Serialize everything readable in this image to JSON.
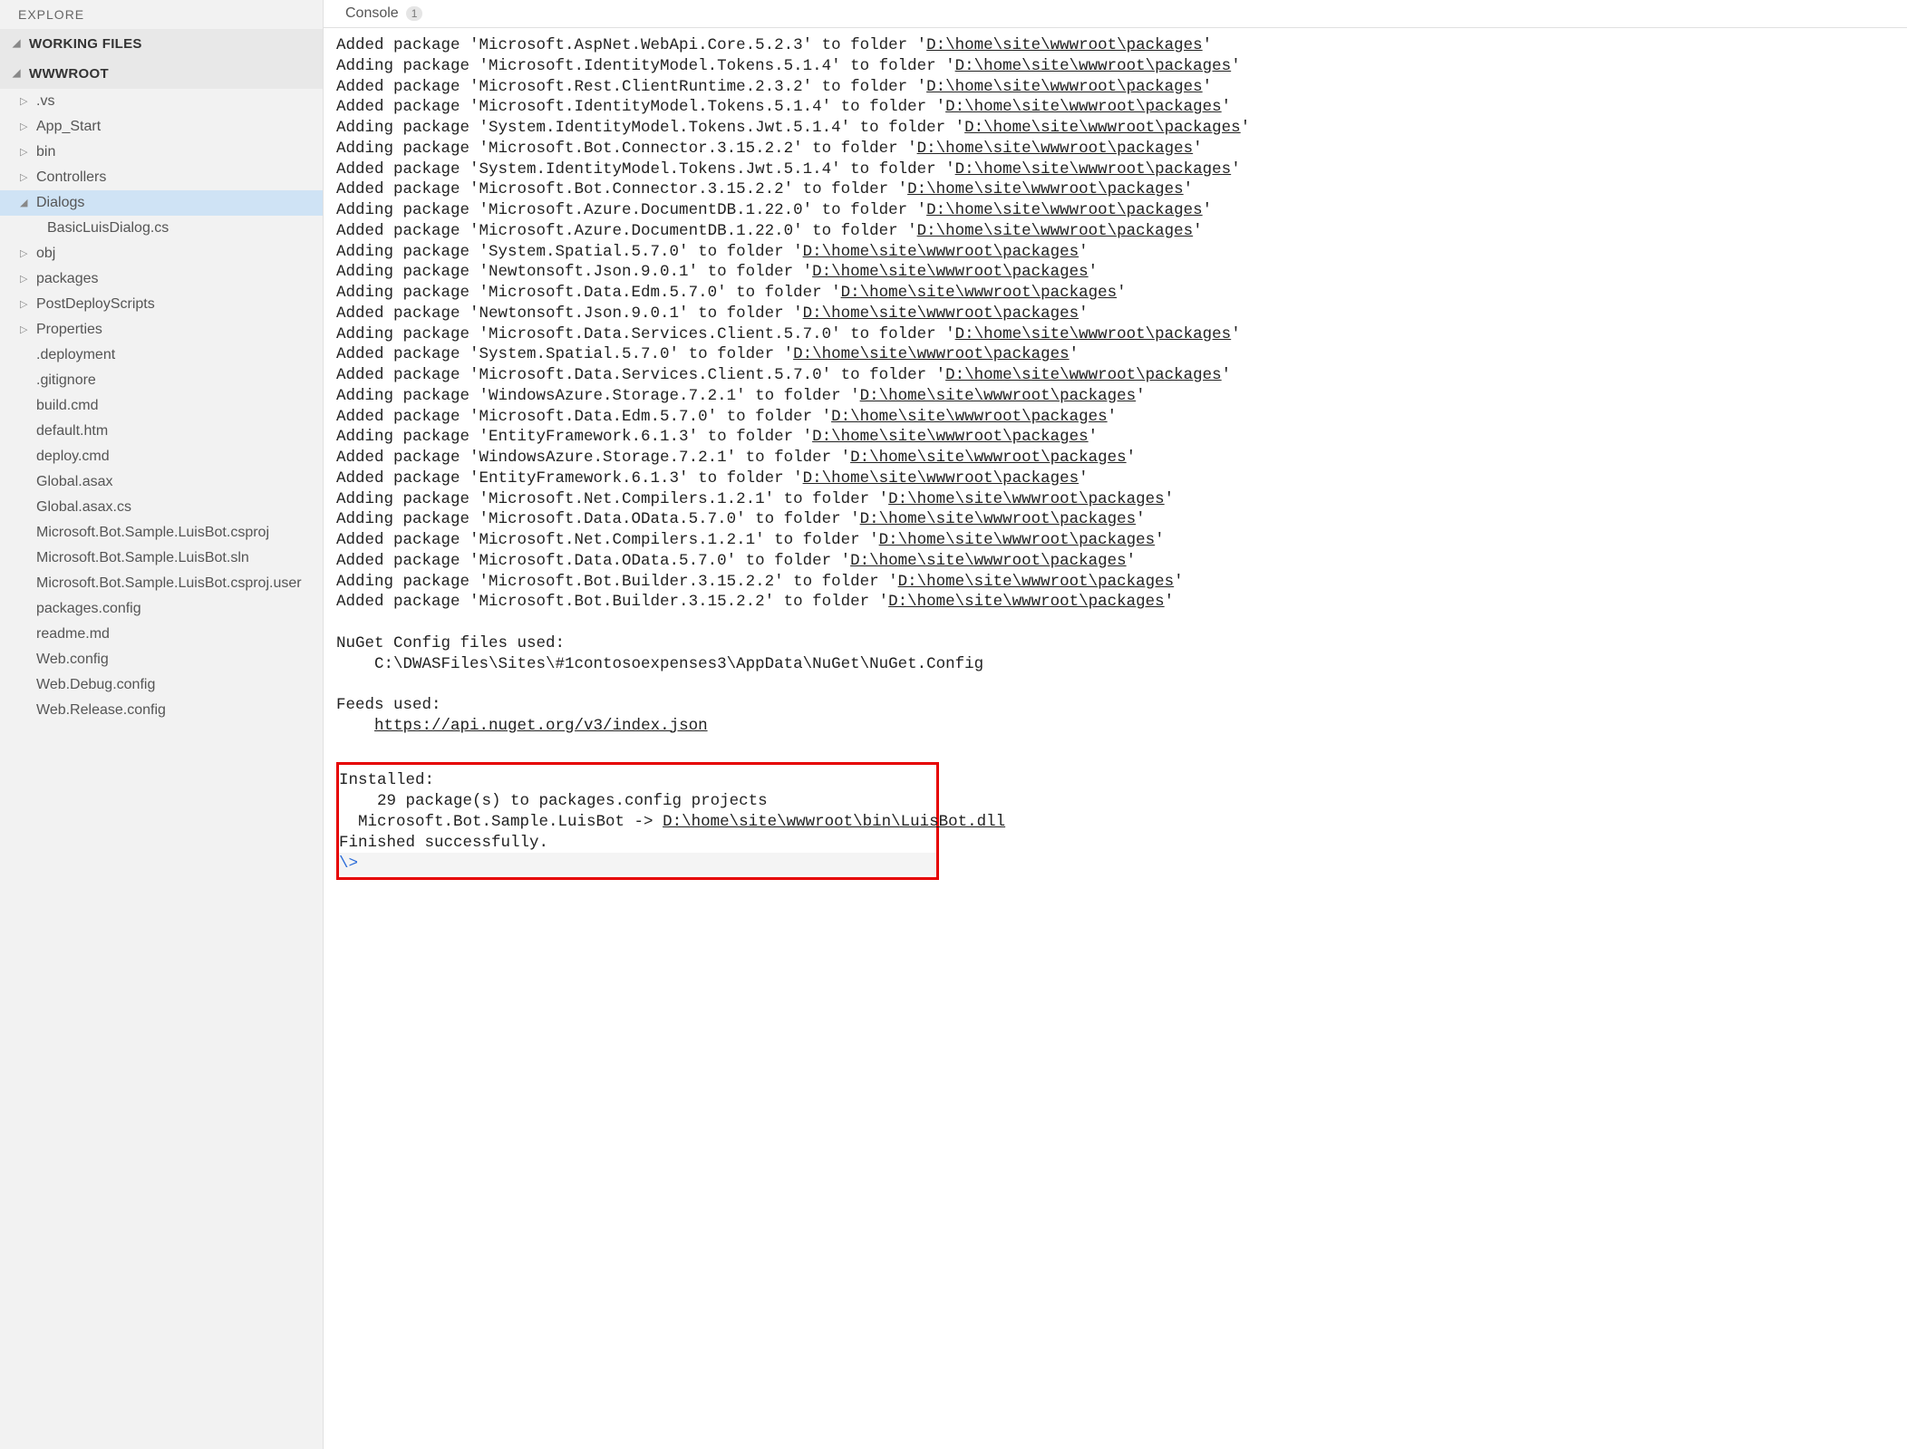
{
  "sidebar": {
    "explore_label": "EXPLORE",
    "working_files_label": "WORKING FILES",
    "root_label": "WWWROOT",
    "selected": "Dialogs",
    "tree": [
      {
        "label": ".vs",
        "expandable": true,
        "open": false
      },
      {
        "label": "App_Start",
        "expandable": true,
        "open": false
      },
      {
        "label": "bin",
        "expandable": true,
        "open": false
      },
      {
        "label": "Controllers",
        "expandable": true,
        "open": false
      },
      {
        "label": "Dialogs",
        "expandable": true,
        "open": true,
        "children": [
          {
            "label": "BasicLuisDialog.cs"
          }
        ]
      },
      {
        "label": "obj",
        "expandable": true,
        "open": false
      },
      {
        "label": "packages",
        "expandable": true,
        "open": false
      },
      {
        "label": "PostDeployScripts",
        "expandable": true,
        "open": false
      },
      {
        "label": "Properties",
        "expandable": true,
        "open": false
      },
      {
        "label": ".deployment",
        "expandable": false
      },
      {
        "label": ".gitignore",
        "expandable": false
      },
      {
        "label": "build.cmd",
        "expandable": false
      },
      {
        "label": "default.htm",
        "expandable": false
      },
      {
        "label": "deploy.cmd",
        "expandable": false
      },
      {
        "label": "Global.asax",
        "expandable": false
      },
      {
        "label": "Global.asax.cs",
        "expandable": false
      },
      {
        "label": "Microsoft.Bot.Sample.LuisBot.csproj",
        "expandable": false
      },
      {
        "label": "Microsoft.Bot.Sample.LuisBot.sln",
        "expandable": false
      },
      {
        "label": "Microsoft.Bot.Sample.LuisBot.csproj.user",
        "expandable": false
      },
      {
        "label": "packages.config",
        "expandable": false
      },
      {
        "label": "readme.md",
        "expandable": false
      },
      {
        "label": "Web.config",
        "expandable": false
      },
      {
        "label": "Web.Debug.config",
        "expandable": false
      },
      {
        "label": "Web.Release.config",
        "expandable": false
      }
    ]
  },
  "tab": {
    "label": "Console",
    "badge": "1"
  },
  "packages_path": "D:\\home\\site\\wwwroot\\packages",
  "console_lines": [
    {
      "verb": "Added",
      "pkg": "Microsoft.AspNet.WebApi.Core.5.2.3"
    },
    {
      "verb": "Adding",
      "pkg": "Microsoft.IdentityModel.Tokens.5.1.4"
    },
    {
      "verb": "Added",
      "pkg": "Microsoft.Rest.ClientRuntime.2.3.2"
    },
    {
      "verb": "Added",
      "pkg": "Microsoft.IdentityModel.Tokens.5.1.4"
    },
    {
      "verb": "Adding",
      "pkg": "System.IdentityModel.Tokens.Jwt.5.1.4"
    },
    {
      "verb": "Adding",
      "pkg": "Microsoft.Bot.Connector.3.15.2.2"
    },
    {
      "verb": "Added",
      "pkg": "System.IdentityModel.Tokens.Jwt.5.1.4"
    },
    {
      "verb": "Added",
      "pkg": "Microsoft.Bot.Connector.3.15.2.2"
    },
    {
      "verb": "Adding",
      "pkg": "Microsoft.Azure.DocumentDB.1.22.0"
    },
    {
      "verb": "Added",
      "pkg": "Microsoft.Azure.DocumentDB.1.22.0"
    },
    {
      "verb": "Adding",
      "pkg": "System.Spatial.5.7.0"
    },
    {
      "verb": "Adding",
      "pkg": "Newtonsoft.Json.9.0.1"
    },
    {
      "verb": "Adding",
      "pkg": "Microsoft.Data.Edm.5.7.0"
    },
    {
      "verb": "Added",
      "pkg": "Newtonsoft.Json.9.0.1"
    },
    {
      "verb": "Adding",
      "pkg": "Microsoft.Data.Services.Client.5.7.0"
    },
    {
      "verb": "Added",
      "pkg": "System.Spatial.5.7.0"
    },
    {
      "verb": "Added",
      "pkg": "Microsoft.Data.Services.Client.5.7.0"
    },
    {
      "verb": "Adding",
      "pkg": "WindowsAzure.Storage.7.2.1"
    },
    {
      "verb": "Added",
      "pkg": "Microsoft.Data.Edm.5.7.0"
    },
    {
      "verb": "Adding",
      "pkg": "EntityFramework.6.1.3"
    },
    {
      "verb": "Added",
      "pkg": "WindowsAzure.Storage.7.2.1"
    },
    {
      "verb": "Added",
      "pkg": "EntityFramework.6.1.3"
    },
    {
      "verb": "Adding",
      "pkg": "Microsoft.Net.Compilers.1.2.1"
    },
    {
      "verb": "Adding",
      "pkg": "Microsoft.Data.OData.5.7.0"
    },
    {
      "verb": "Added",
      "pkg": "Microsoft.Net.Compilers.1.2.1"
    },
    {
      "verb": "Added",
      "pkg": "Microsoft.Data.OData.5.7.0"
    },
    {
      "verb": "Adding",
      "pkg": "Microsoft.Bot.Builder.3.15.2.2"
    },
    {
      "verb": "Added",
      "pkg": "Microsoft.Bot.Builder.3.15.2.2"
    }
  ],
  "nuget": {
    "config_heading": "NuGet Config files used:",
    "config_path": "C:\\DWASFiles\\Sites\\#1contosoexpenses3\\AppData\\NuGet\\NuGet.Config",
    "feeds_heading": "Feeds used:",
    "feed_url": "https://api.nuget.org/v3/index.json"
  },
  "result": {
    "installed_heading": "Installed:",
    "installed_detail": "29 package(s) to packages.config projects",
    "build_line_prefix": "  Microsoft.Bot.Sample.LuisBot -> ",
    "build_output": "D:\\home\\site\\wwwroot\\bin\\LuisBot.dll",
    "finished": "Finished successfully.",
    "prompt": "\\>"
  }
}
